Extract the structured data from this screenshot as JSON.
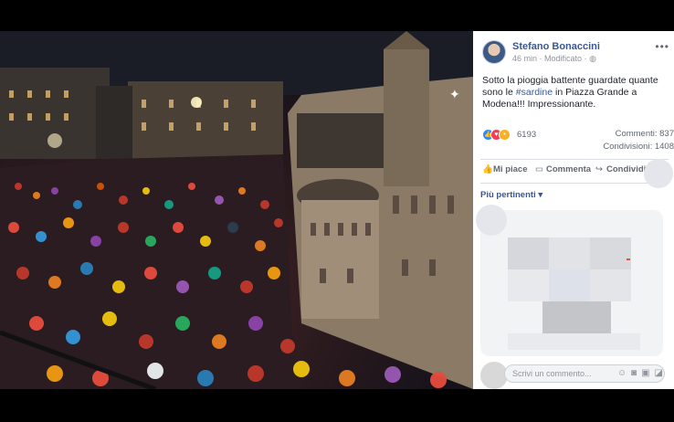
{
  "post": {
    "author": "Stefano Bonaccini",
    "time": "46 min",
    "edited": "· Modificato ·",
    "privacy_icon": "globe-icon",
    "more_icon": "more-dots-icon",
    "text_before": "Sotto la pioggia battente guardate quante sono le ",
    "hashtag": "#sardine",
    "text_after": " in Piazza Grande a Modena!!! Impressionante."
  },
  "reactions": {
    "count": "6193",
    "icons": [
      "like-reaction-icon",
      "love-reaction-icon",
      "wow-reaction-icon"
    ]
  },
  "stats": {
    "comments": "Commenti: 837",
    "shares": "Condivisioni: 1408"
  },
  "actions": {
    "like": "Mi piace",
    "comment": "Commenta",
    "share": "Condividi"
  },
  "comments": {
    "sort_label": "Più pertinenti ▾",
    "input_placeholder": "Scrivi un commento..."
  },
  "colors": {
    "link": "#385898",
    "like": "#2d88ff",
    "love": "#f33e58",
    "wow": "#f7b125"
  }
}
